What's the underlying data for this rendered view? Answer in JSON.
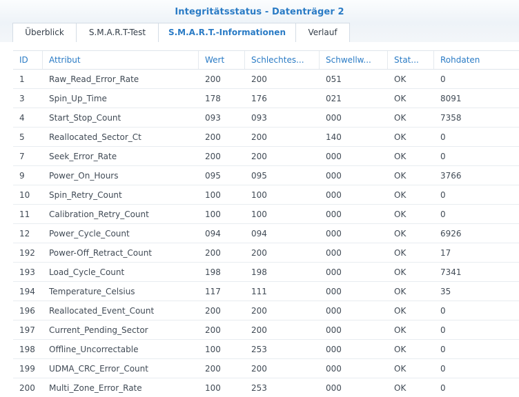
{
  "window": {
    "title": "Integritätsstatus - Datenträger 2"
  },
  "tabs": [
    {
      "label": "Überblick",
      "active": false
    },
    {
      "label": "S.M.A.R.T-Test",
      "active": false
    },
    {
      "label": "S.M.A.R.T.-Informationen",
      "active": true
    },
    {
      "label": "Verlauf",
      "active": false
    }
  ],
  "table": {
    "columns": [
      "ID",
      "Attribut",
      "Wert",
      "Schlechtes...",
      "Schwellw...",
      "Stat...",
      "Rohdaten"
    ],
    "rows": [
      [
        "1",
        "Raw_Read_Error_Rate",
        "200",
        "200",
        "051",
        "OK",
        "0"
      ],
      [
        "3",
        "Spin_Up_Time",
        "178",
        "176",
        "021",
        "OK",
        "8091"
      ],
      [
        "4",
        "Start_Stop_Count",
        "093",
        "093",
        "000",
        "OK",
        "7358"
      ],
      [
        "5",
        "Reallocated_Sector_Ct",
        "200",
        "200",
        "140",
        "OK",
        "0"
      ],
      [
        "7",
        "Seek_Error_Rate",
        "200",
        "200",
        "000",
        "OK",
        "0"
      ],
      [
        "9",
        "Power_On_Hours",
        "095",
        "095",
        "000",
        "OK",
        "3766"
      ],
      [
        "10",
        "Spin_Retry_Count",
        "100",
        "100",
        "000",
        "OK",
        "0"
      ],
      [
        "11",
        "Calibration_Retry_Count",
        "100",
        "100",
        "000",
        "OK",
        "0"
      ],
      [
        "12",
        "Power_Cycle_Count",
        "094",
        "094",
        "000",
        "OK",
        "6926"
      ],
      [
        "192",
        "Power-Off_Retract_Count",
        "200",
        "200",
        "000",
        "OK",
        "17"
      ],
      [
        "193",
        "Load_Cycle_Count",
        "198",
        "198",
        "000",
        "OK",
        "7341"
      ],
      [
        "194",
        "Temperature_Celsius",
        "117",
        "111",
        "000",
        "OK",
        "35"
      ],
      [
        "196",
        "Reallocated_Event_Count",
        "200",
        "200",
        "000",
        "OK",
        "0"
      ],
      [
        "197",
        "Current_Pending_Sector",
        "200",
        "200",
        "000",
        "OK",
        "0"
      ],
      [
        "198",
        "Offline_Uncorrectable",
        "100",
        "253",
        "000",
        "OK",
        "0"
      ],
      [
        "199",
        "UDMA_CRC_Error_Count",
        "200",
        "200",
        "000",
        "OK",
        "0"
      ],
      [
        "200",
        "Multi_Zone_Error_Rate",
        "100",
        "253",
        "000",
        "OK",
        "0"
      ]
    ]
  }
}
